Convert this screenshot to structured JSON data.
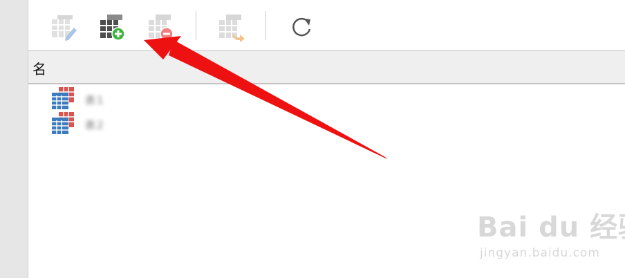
{
  "toolbar": {
    "buttons": [
      {
        "name": "edit-table",
        "icon": "table-edit-icon",
        "enabled": false
      },
      {
        "name": "new-table",
        "icon": "table-add-icon",
        "enabled": true
      },
      {
        "name": "delete-table",
        "icon": "table-delete-icon",
        "enabled": false
      },
      {
        "name": "import-export-table",
        "icon": "table-transfer-icon",
        "enabled": false
      },
      {
        "name": "refresh",
        "icon": "refresh-icon",
        "enabled": true
      }
    ]
  },
  "table_list": {
    "column_header": "名",
    "rows": [
      {
        "name": "表1",
        "icon": "table-icon"
      },
      {
        "name": "表2",
        "icon": "table-icon"
      }
    ]
  },
  "annotation": {
    "arrow_color": "#ee1111",
    "points_to": "new-table"
  },
  "watermark": {
    "brand": "Bai du 经验",
    "url": "jingyan.baidu.com"
  },
  "colors": {
    "add_green": "#3fb33f",
    "delete_red": "#f08080",
    "table_blue": "#3b7bbf",
    "table_orange": "#d9534f"
  }
}
